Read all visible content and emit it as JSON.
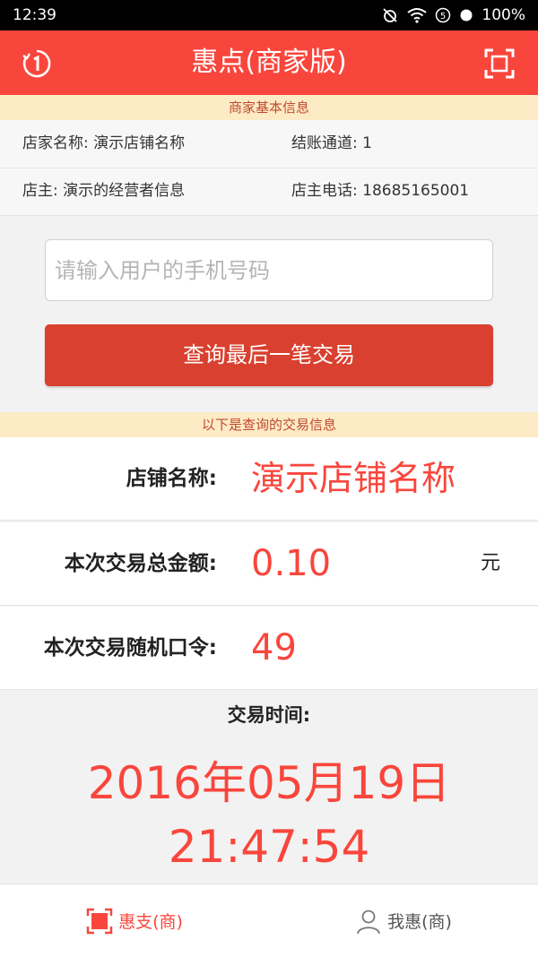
{
  "status_bar": {
    "time": "12:39",
    "battery": "100%"
  },
  "header": {
    "title": "惠点(商家版)",
    "left_icon": "info-refresh-icon",
    "right_icon": "scan-icon"
  },
  "merchant_info": {
    "section_title": "商家基本信息",
    "shop_name": "店家名称: 演示店铺名称",
    "channel": "结账通道: 1",
    "owner": "店主: 演示的经营者信息",
    "owner_phone": "店主电话: 18685165001"
  },
  "query": {
    "placeholder": "请输入用户的手机号码",
    "value": "",
    "button_label": "查询最后一笔交易"
  },
  "result": {
    "section_title": "以下是查询的交易信息",
    "shop_label": "店铺名称:",
    "shop_value": "演示店铺名称",
    "amount_label": "本次交易总金额:",
    "amount_value": "0.10",
    "amount_unit": "元",
    "code_label": "本次交易随机口令:",
    "code_value": "49",
    "time_label": "交易时间:",
    "time_date": "2016年05月19日",
    "time_clock": "21:47:54"
  },
  "tabs": [
    {
      "label": "惠支(商)",
      "icon": "scan-frame-icon",
      "active": true
    },
    {
      "label": "我惠(商)",
      "icon": "user-icon",
      "active": false
    }
  ],
  "colors": {
    "accent": "#f9463c",
    "button": "#d9402f",
    "section_bg": "#fdebc6"
  }
}
